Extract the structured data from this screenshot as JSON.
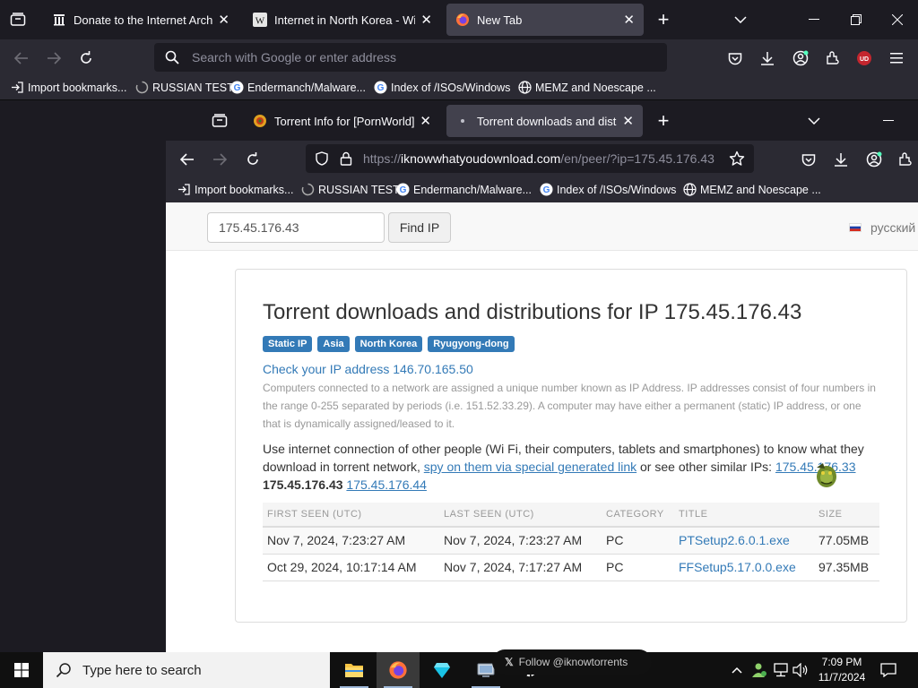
{
  "outer_browser": {
    "tabs": [
      {
        "title": "Donate to the Internet Archive!",
        "favicon": "archive-icon"
      },
      {
        "title": "Internet in North Korea - Wikipedia",
        "favicon": "wikipedia-icon"
      },
      {
        "title": "New Tab",
        "favicon": "firefox-icon",
        "active": true
      }
    ],
    "search_placeholder": "Search with Google or enter address",
    "bookmarks": [
      {
        "label": "Import bookmarks...",
        "icon": "import-icon"
      },
      {
        "label": "RUSSIAN TEST",
        "icon": "loading-icon"
      },
      {
        "label": "Endermanch/Malware...",
        "icon": "google-icon"
      },
      {
        "label": "Index of /ISOs/Windows",
        "icon": "google-icon"
      },
      {
        "label": "MEMZ and Noescape ...",
        "icon": "globe-icon"
      }
    ],
    "extension_badge": "UD"
  },
  "inner_browser": {
    "tabs": [
      {
        "title": "Torrent Info for [PornWorld] Ed",
        "favicon": "torrent-site-icon"
      },
      {
        "title": "Torrent downloads and distribu",
        "favicon": "dot-icon",
        "active": true
      }
    ],
    "url": {
      "prefix": "https://",
      "domain": "iknowwhatyoudownload.com",
      "path": "/en/peer/?ip=175.45.176.43"
    },
    "bookmarks": [
      {
        "label": "Import bookmarks...",
        "icon": "import-icon"
      },
      {
        "label": "RUSSIAN TEST",
        "icon": "loading-icon"
      },
      {
        "label": "Endermanch/Malware...",
        "icon": "google-icon"
      },
      {
        "label": "Index of /ISOs/Windows",
        "icon": "google-icon"
      },
      {
        "label": "MEMZ and Noescape ...",
        "icon": "globe-icon"
      }
    ]
  },
  "page": {
    "ip_input_value": "175.45.176.43",
    "find_button": "Find IP",
    "language": "русский",
    "title": "Torrent downloads and distributions for IP 175.45.176.43",
    "labels": [
      "Static IP",
      "Asia",
      "North Korea",
      "Ryugyong-dong"
    ],
    "check_ip": "Check your IP address 146.70.165.50",
    "explanation": "Computers connected to a network are assigned a unique number known as IP Address. IP addresses consist of four numbers in the range 0-255 separated by periods (i.e. 151.52.33.29). A computer may have either a permanent (static) IP address, or one that is dynamically assigned/leased to it.",
    "intro_text": "Use internet connection of other people (Wi Fi, their computers, tablets and smartphones) to know what they download in torrent network,",
    "spy_link": "spy on them via special generated link",
    "similar_text": "or see other similar IPs:",
    "similar_ips": [
      "175.45.176.33",
      "175.45.176.43",
      "175.45.176.44"
    ],
    "table": {
      "headers": [
        "FIRST SEEN (UTC)",
        "LAST SEEN (UTC)",
        "CATEGORY",
        "TITLE",
        "SIZE"
      ],
      "rows": [
        [
          "Nov 7, 2024, 7:23:27 AM",
          "Nov 7, 2024, 7:23:27 AM",
          "PC",
          "PTSetup2.6.0.1.exe",
          "77.05MB"
        ],
        [
          "Oct 29, 2024, 10:17:14 AM",
          "Nov 7, 2024, 7:17:27 AM",
          "PC",
          "FFSetup5.17.0.0.exe",
          "97.35MB"
        ]
      ]
    },
    "follow_popup": "Follow @iknowtorrents"
  },
  "taskbar": {
    "search_placeholder": "Type here to search",
    "apps": [
      "file-explorer-icon",
      "firefox-icon",
      "gem-app-icon",
      "virtual-machine-icon",
      "settings-icon"
    ],
    "time": "7:09 PM",
    "date": "11/7/2024"
  },
  "colors": {
    "firefox_dark": "#1c1b22",
    "firefox_toolbar": "#2b2a33",
    "active_tab": "#42414d",
    "link_blue": "#337ab7",
    "extension_red": "#c4262e"
  }
}
